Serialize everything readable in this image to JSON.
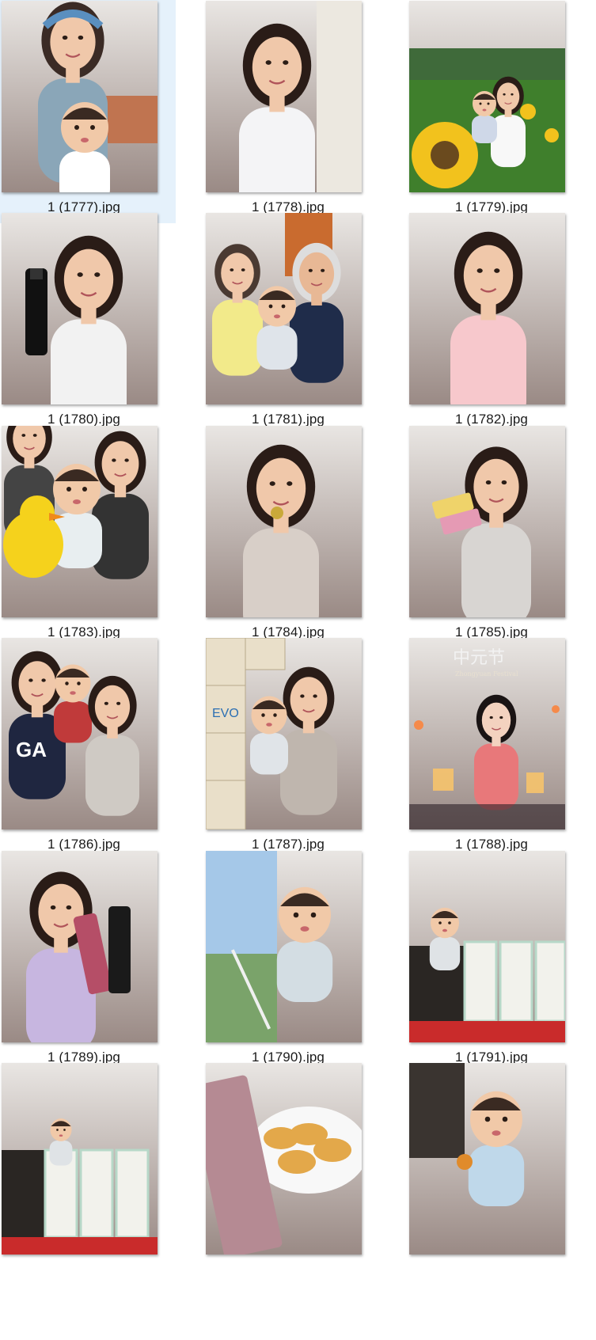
{
  "view": {
    "selected_index": 0
  },
  "files": [
    {
      "name": "1 (1777).jpg",
      "scene": "selfie-mother-baby-headband"
    },
    {
      "name": "1 (1778).jpg",
      "scene": "selfie-woman-white-top"
    },
    {
      "name": "1 (1779).jpg",
      "scene": "sunflower-field-mother-baby"
    },
    {
      "name": "1 (1780).jpg",
      "scene": "selfie-woman-black-bottle"
    },
    {
      "name": "1 (1781).jpg",
      "scene": "grandparents-with-baby"
    },
    {
      "name": "1 (1782).jpg",
      "scene": "selfie-woman-pink-shirt"
    },
    {
      "name": "1 (1783).jpg",
      "scene": "family-with-yellow-duck"
    },
    {
      "name": "1 (1784).jpg",
      "scene": "woman-eating-snack"
    },
    {
      "name": "1 (1785).jpg",
      "scene": "woman-with-snack-packs"
    },
    {
      "name": "1 (1786).jpg",
      "scene": "family-in-store"
    },
    {
      "name": "1 (1787).jpg",
      "scene": "woman-baby-with-boxes"
    },
    {
      "name": "1 (1788).jpg",
      "scene": "zhongyuan-festival-poster",
      "poster_title": "中元节",
      "poster_subtitle": "Zhongyuan Festival"
    },
    {
      "name": "1 (1789).jpg",
      "scene": "woman-with-cosmetic-tubes"
    },
    {
      "name": "1 (1790).jpg",
      "scene": "baby-with-straw-window"
    },
    {
      "name": "1 (1791).jpg",
      "scene": "baby-in-playpen"
    },
    {
      "name": "",
      "scene": "baby-in-playpen-room"
    },
    {
      "name": "",
      "scene": "garlic-bread-plate"
    },
    {
      "name": "",
      "scene": "baby-eating"
    }
  ]
}
